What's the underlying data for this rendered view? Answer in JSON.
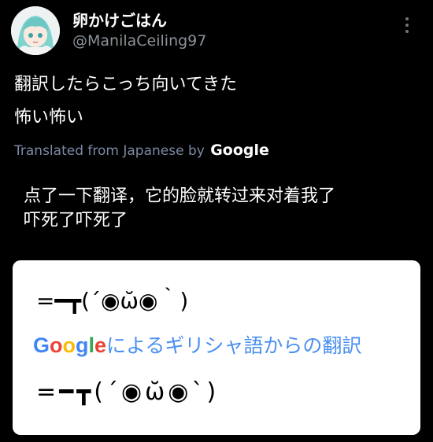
{
  "post": {
    "author_name": "卵かけごはん",
    "author_handle": "@ManilaCeiling97",
    "text_line1": "翻訳したらこっち向いてきた",
    "text_line2": "怖い怖い",
    "translated_label": "Translated from Japanese by",
    "translated_brand": "Google",
    "translation_line1": "点了一下翻译，它的脸就转过来对着我了",
    "translation_line2": "吓死了吓死了"
  },
  "image": {
    "kaomoji_top": "=━┳(´◉ω̆◉｀)",
    "google_brand": "Google",
    "google_caption": "によるギリシャ語からの翻訳",
    "kaomoji_bottom": "=━┳(´◉ω̆◉`)"
  },
  "icons": {
    "avatar": "avatar-anime-character",
    "more": "more-vertical-icon"
  },
  "colors": {
    "background": "#000000",
    "handle": "#8b9298",
    "translated_label": "#7c8aa4",
    "google_blue": "#4285f4",
    "google_red": "#ea4335",
    "google_yellow": "#fbbc05",
    "google_green": "#34a853",
    "caption_blue": "#4a8ff0"
  }
}
